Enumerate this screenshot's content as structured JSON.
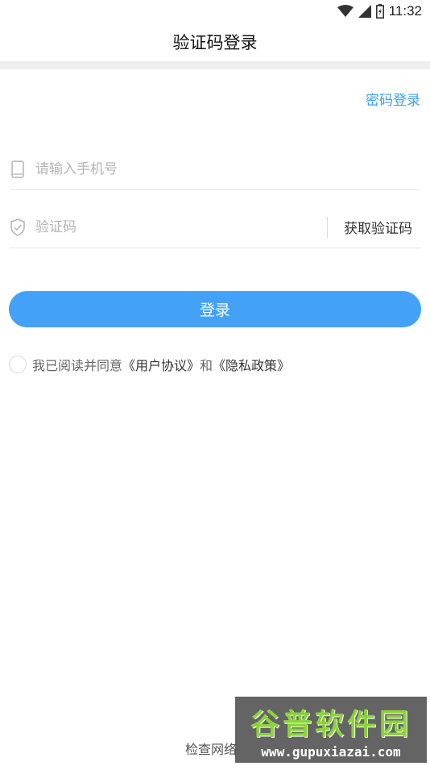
{
  "status_bar": {
    "time": "11:32",
    "icons": [
      "wifi-icon",
      "signal-icon",
      "battery-icon"
    ]
  },
  "header": {
    "title": "验证码登录"
  },
  "links": {
    "password_login": "密码登录"
  },
  "form": {
    "phone": {
      "placeholder": "请输入手机号",
      "value": "",
      "icon": "phone-icon"
    },
    "code": {
      "placeholder": "验证码",
      "value": "",
      "icon": "shield-check-icon",
      "get_code_label": "获取验证码"
    },
    "submit_label": "登录"
  },
  "agreement": {
    "checked": false,
    "prefix": "我已阅读并同意",
    "user_agreement": "《用户协议》",
    "conjunction": "和",
    "privacy_policy": "《隐私政策》"
  },
  "footer": {
    "text": "检查网络"
  },
  "watermark": {
    "title": "谷普软件园",
    "url": "www.gupuxiazai.com"
  },
  "colors": {
    "accent": "#43a2f7",
    "link": "#3d9ef3",
    "divider": "#efefef"
  }
}
